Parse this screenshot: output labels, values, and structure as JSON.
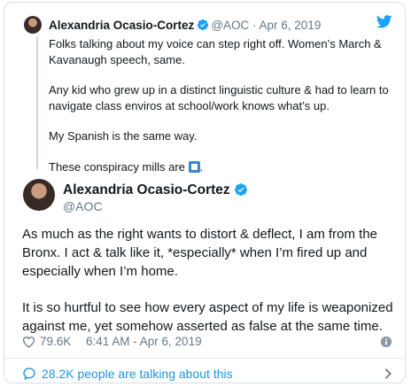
{
  "quoted": {
    "name": "Alexandria Ocasio-Cortez",
    "meta": "@AOC · Apr 6, 2019",
    "paragraphs": [
      "Folks talking about my voice can step right off. Women’s March & Kavanaugh speech, same.",
      "Any kid who grew up in a distinct linguistic culture & had to learn to navigate class enviros at school/work knows what’s up.",
      "My Spanish is the same way.",
      "These conspiracy mills are"
    ],
    "final_suffix": "."
  },
  "main": {
    "name": "Alexandria Ocasio-Cortez",
    "handle": "@AOC",
    "paragraphs": [
      "As much as the right wants to distort & deflect, I am from the Bronx. I act & talk like it, *especially* when I’m fired up and especially when I’m home.",
      "It is so hurtful to see how every aspect of my life is weaponized against me, yet somehow asserted as false at the same time."
    ],
    "likes": "79.6K",
    "timestamp": "6:41 AM - Apr 6, 2019"
  },
  "footer": {
    "talking": "28.2K people are talking about this"
  },
  "colors": {
    "accent": "#1da1f2",
    "link": "#1b95e0",
    "muted": "#657786",
    "border": "#d8dfe5"
  },
  "icons": [
    "verified-badge-icon",
    "twitter-bird-icon",
    "chart-emoji-icon",
    "heart-icon",
    "info-icon",
    "people-icon",
    "chevron-right-icon"
  ]
}
